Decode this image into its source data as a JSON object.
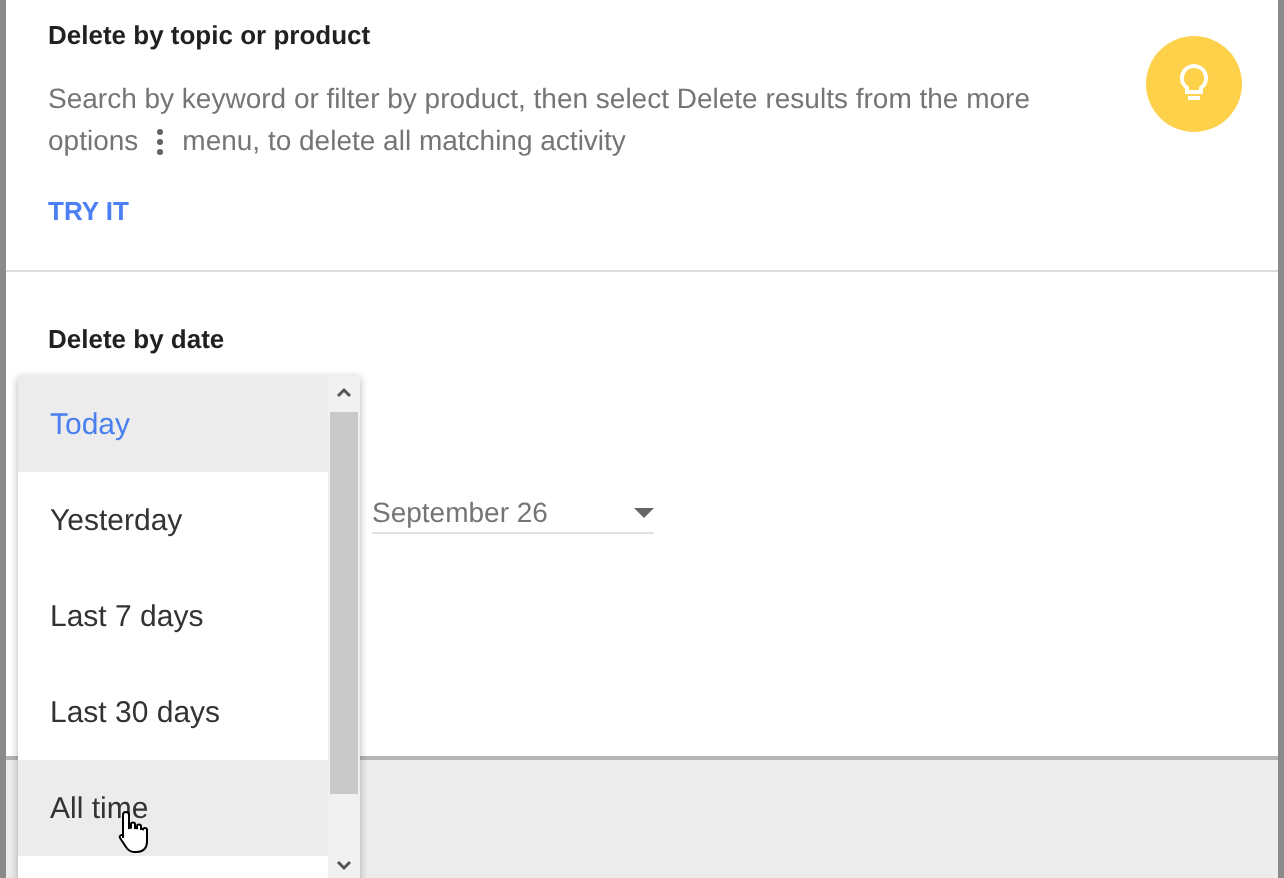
{
  "topic_section": {
    "title": "Delete by topic or product",
    "description_line": "Search by keyword or filter by product, then select Delete results from the more",
    "description_before": "options",
    "description_after": "menu, to delete all matching activity",
    "action": "TRY IT"
  },
  "date_section": {
    "title": "Delete by date",
    "date_field": {
      "value": "September 26"
    },
    "range_menu": [
      {
        "label": "Today",
        "selected": true,
        "hovered": false
      },
      {
        "label": "Yesterday",
        "selected": false,
        "hovered": false
      },
      {
        "label": "Last 7 days",
        "selected": false,
        "hovered": false
      },
      {
        "label": "Last 30 days",
        "selected": false,
        "hovered": false
      },
      {
        "label": "All time",
        "selected": false,
        "hovered": true
      }
    ]
  }
}
